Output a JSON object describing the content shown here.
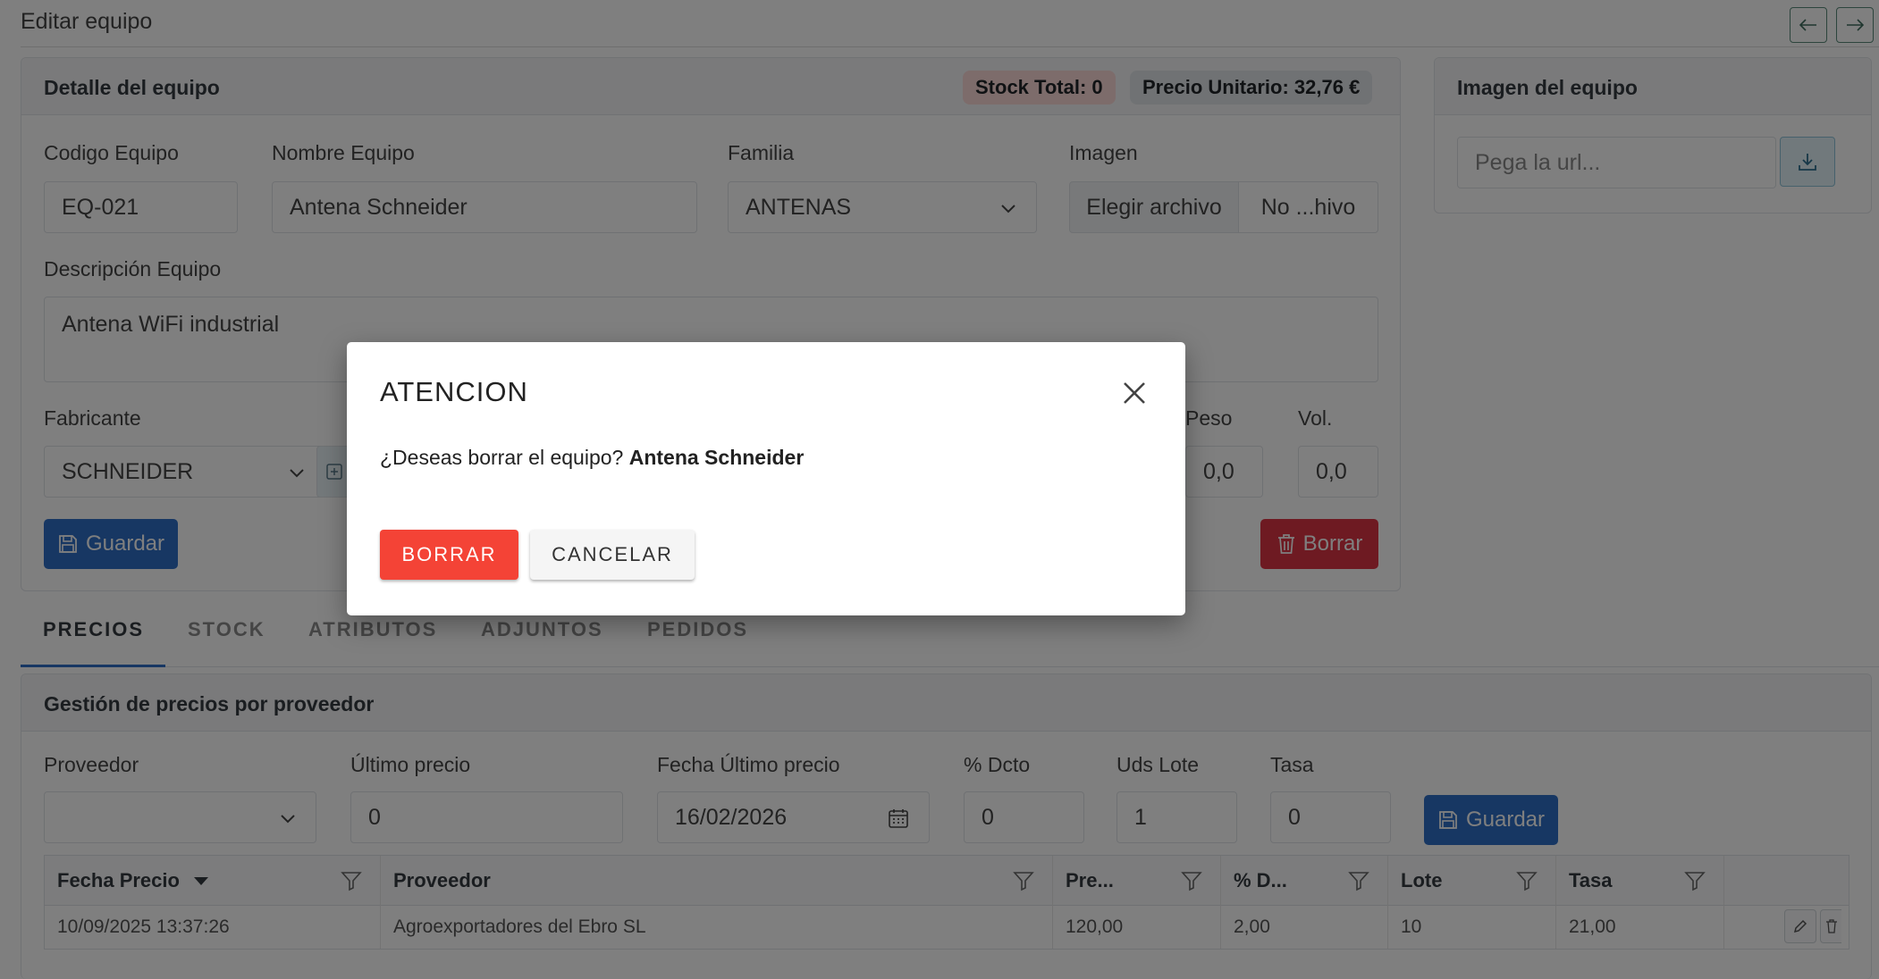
{
  "header": {
    "title": "Editar equipo",
    "prev_icon": "arrow-left-icon",
    "next_icon": "arrow-right-icon"
  },
  "detail": {
    "title": "Detalle del equipo",
    "stock_badge": "Stock Total: 0",
    "price_badge": "Precio Unitario: 32,76 €",
    "codigo_label": "Codigo Equipo",
    "codigo_value": "EQ-021",
    "nombre_label": "Nombre Equipo",
    "nombre_value": "Antena Schneider",
    "familia_label": "Familia",
    "familia_value": "ANTENAS",
    "imagen_label": "Imagen",
    "file_button": "Elegir archivo",
    "file_status": "No ...hivo",
    "descripcion_label": "Descripción Equipo",
    "descripcion_value": "Antena WiFi industrial",
    "fabricante_label": "Fabricante",
    "fabricante_value": "SCHNEIDER",
    "peso_label": "Peso",
    "peso_value": "0,0",
    "vol_label": "Vol.",
    "vol_value": "0,0",
    "guardar_label": "Guardar",
    "borrar_label": "Borrar"
  },
  "image_card": {
    "title": "Imagen del equipo",
    "url_placeholder": "Pega la url..."
  },
  "tabs": [
    {
      "label": "PRECIOS",
      "active": true
    },
    {
      "label": "STOCK",
      "active": false
    },
    {
      "label": "ATRIBUTOS",
      "active": false
    },
    {
      "label": "ADJUNTOS",
      "active": false
    },
    {
      "label": "PEDIDOS",
      "active": false
    }
  ],
  "prices": {
    "title": "Gestión de precios por proveedor",
    "proveedor_label": "Proveedor",
    "ultimo_precio_label": "Último precio",
    "ultimo_precio_value": "0",
    "fecha_label": "Fecha Último precio",
    "fecha_value": "16/02/2026",
    "dcto_label": "% Dcto",
    "dcto_value": "0",
    "lote_label": "Uds Lote",
    "lote_value": "1",
    "tasa_label": "Tasa",
    "tasa_value": "0",
    "guardar_label": "Guardar",
    "columns": [
      "Fecha Precio",
      "Proveedor",
      "Pre...",
      "% D...",
      "Lote",
      "Tasa"
    ],
    "rows": [
      [
        "10/09/2025 13:37:26",
        "Agroexportadores del Ebro SL",
        "120,00",
        "2,00",
        "10",
        "21,00"
      ]
    ]
  },
  "modal": {
    "title": "ATENCION",
    "question": "¿Deseas borrar el equipo? ",
    "item_name": "Antena Schneider",
    "confirm_label": "BORRAR",
    "cancel_label": "CANCELAR"
  },
  "colors": {
    "primary": "#2f6fc6",
    "danger": "#dc3545",
    "modal_confirm": "#f44336"
  }
}
